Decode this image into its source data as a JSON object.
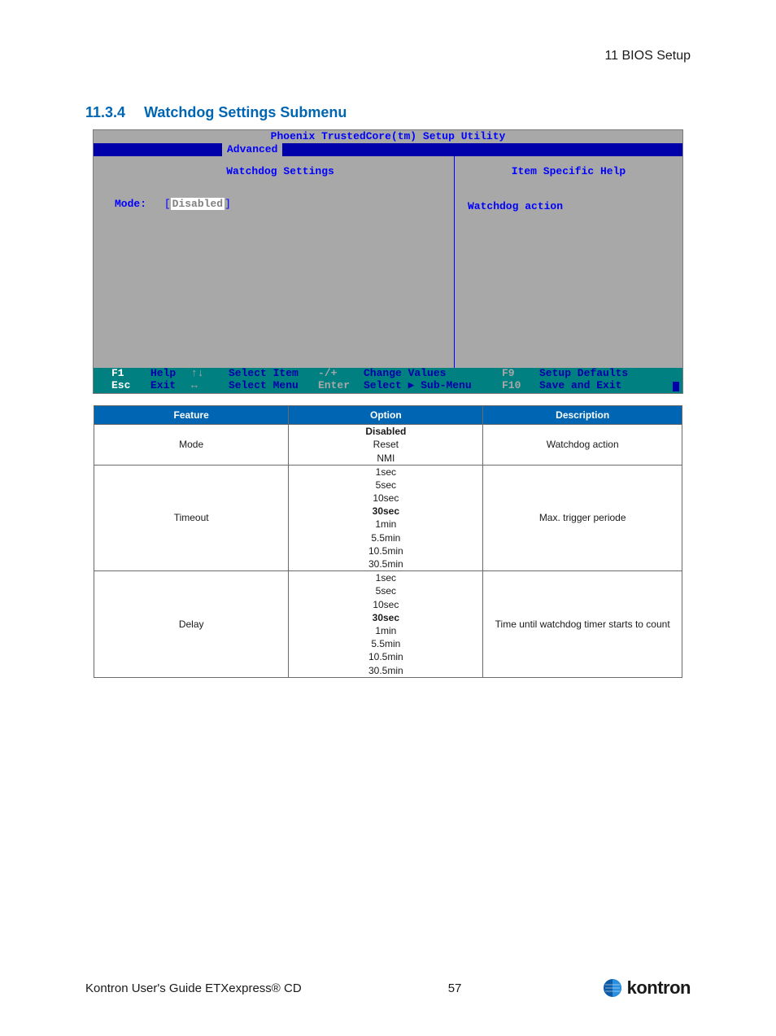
{
  "running_header": "11 BIOS Setup",
  "heading": {
    "number": "11.3.4",
    "title": "Watchdog Settings Submenu"
  },
  "bios": {
    "utility_title": "Phoenix TrustedCore(tm) Setup Utility",
    "menu_tab": "Advanced",
    "page_title": "Watchdog Settings",
    "help_header": "Item Specific Help",
    "help_text": "Watchdog action",
    "mode_label": "Mode:",
    "mode_value": "Disabled",
    "footer": {
      "r1": {
        "k1": "F1",
        "a1": "Help",
        "arr1": "↑↓",
        "a2": "Select Item",
        "k2": "-/+",
        "a3": "Change Values",
        "k3": "F9",
        "a4": "Setup Defaults"
      },
      "r2": {
        "k1": "Esc",
        "a1": "Exit",
        "arr1": "↔",
        "a2": "Select Menu",
        "k2": "Enter",
        "a3": "Select ▶ Sub-Menu",
        "k3": "F10",
        "a4": "Save and Exit"
      }
    }
  },
  "table": {
    "headers": {
      "feature": "Feature",
      "option": "Option",
      "description": "Description"
    },
    "rows": [
      {
        "feature": "Mode",
        "options": [
          {
            "label": "Disabled",
            "default": true
          },
          {
            "label": "Reset",
            "default": false
          },
          {
            "label": "NMI",
            "default": false
          }
        ],
        "description": "Watchdog action"
      },
      {
        "feature": "Timeout",
        "options": [
          {
            "label": "1sec",
            "default": false
          },
          {
            "label": "5sec",
            "default": false
          },
          {
            "label": "10sec",
            "default": false
          },
          {
            "label": "30sec",
            "default": true
          },
          {
            "label": "1min",
            "default": false
          },
          {
            "label": "5.5min",
            "default": false
          },
          {
            "label": "10.5min",
            "default": false
          },
          {
            "label": "30.5min",
            "default": false
          }
        ],
        "description": "Max. trigger periode"
      },
      {
        "feature": "Delay",
        "options": [
          {
            "label": "1sec",
            "default": false
          },
          {
            "label": "5sec",
            "default": false
          },
          {
            "label": "10sec",
            "default": false
          },
          {
            "label": "30sec",
            "default": true
          },
          {
            "label": "1min",
            "default": false
          },
          {
            "label": "5.5min",
            "default": false
          },
          {
            "label": "10.5min",
            "default": false
          },
          {
            "label": "30.5min",
            "default": false
          }
        ],
        "description": "Time until watchdog timer starts to count"
      }
    ]
  },
  "footer": {
    "guide": "Kontron User's Guide ETXexpress® CD",
    "page": "57",
    "brand": "kontron"
  }
}
